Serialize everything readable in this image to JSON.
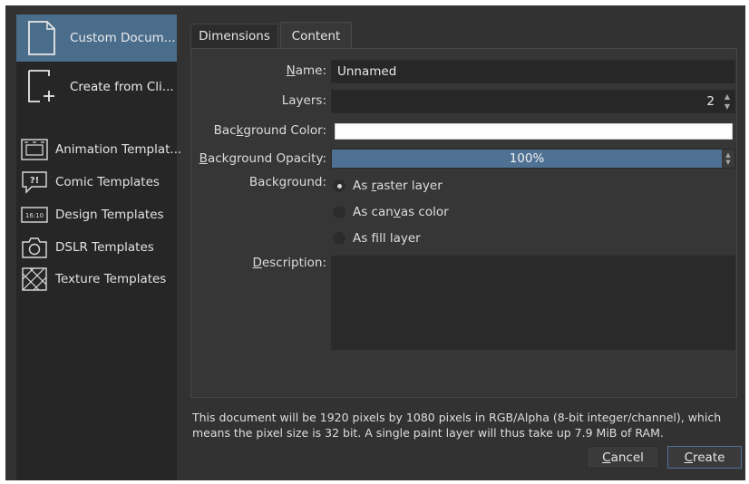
{
  "sidebar": {
    "primary": [
      {
        "label": "Custom Docum...",
        "icon": "document-icon",
        "selected": true
      },
      {
        "label": "Create from Cli...",
        "icon": "new-from-clipboard-icon",
        "selected": false
      }
    ],
    "templates": [
      {
        "label": "Animation Templat...",
        "icon": "animation-template-icon"
      },
      {
        "label": "Comic Templates",
        "icon": "comic-template-icon",
        "glyph": "?!"
      },
      {
        "label": "Design Templates",
        "icon": "design-template-icon",
        "glyph": "16:10"
      },
      {
        "label": "DSLR Templates",
        "icon": "camera-icon"
      },
      {
        "label": "Texture Templates",
        "icon": "texture-template-icon"
      }
    ]
  },
  "tabs": [
    {
      "label": "Dimensions",
      "active": false
    },
    {
      "label": "Content",
      "active": true
    }
  ],
  "content": {
    "name_label": "Name:",
    "name_value": "Unnamed",
    "layers_label": "Layers:",
    "layers_value": "2",
    "bg_color_label": "Background Color:",
    "bg_color_value": "#ffffff",
    "bg_opacity_label": "Background Opacity:",
    "bg_opacity_text": "100%",
    "bg_opacity_fraction": 1.0,
    "background_label": "Background:",
    "background_options": [
      {
        "label": "As raster layer",
        "selected": true
      },
      {
        "label": "As canvas color",
        "selected": false
      },
      {
        "label": "As fill layer",
        "selected": false
      }
    ],
    "description_label": "Description:",
    "description_value": ""
  },
  "footer": {
    "info": "This document will be 1920 pixels by 1080 pixels in RGB/Alpha (8-bit integer/channel), which means the pixel size is 32 bit. A single paint layer will thus take up 7.9 MiB of RAM.",
    "cancel_label": "Cancel",
    "create_label": "Create"
  },
  "colors": {
    "accent": "#4f7294",
    "selected_item": "#4b6d8c",
    "dialog_bg": "#323232",
    "sidebar_bg": "#262626"
  }
}
